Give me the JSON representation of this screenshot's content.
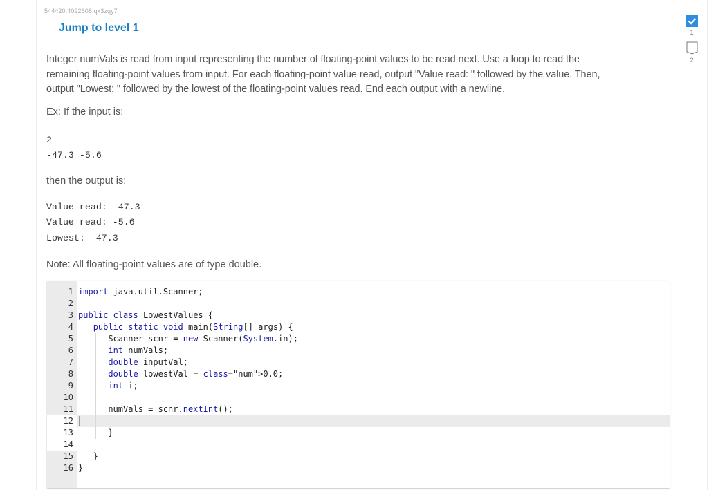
{
  "header": {
    "activity_id": "544420.4092608.qx3zqy7",
    "jump_link": "Jump to level 1"
  },
  "prompt": {
    "text": "Integer numVals is read from input representing the number of floating-point values to be read next. Use a loop to read the remaining floating-point values from input. For each floating-point value read, output \"Value read: \" followed by the value. Then, output \"Lowest: \" followed by the lowest of the floating-point values read. End each output with a newline.",
    "lines": [
      "Integer numVals is read from input representing the number of floating-point values to be read next. Use a loop to read the",
      "remaining floating-point values from input. For each floating-point value read, output \"Value read: \" followed by the value. Then,",
      "output \"Lowest: \" followed by the lowest of the floating-point values read. End each output with a newline."
    ],
    "example_input_label": "Ex: If the input is:",
    "example_input": [
      "2",
      "-47.3 -5.6"
    ],
    "example_output_label": "then the output is:",
    "example_output": [
      "Value read: -47.3",
      "Value read: -5.6",
      "Lowest: -47.3"
    ],
    "note": "Note: All floating-point values are of type double."
  },
  "editor": {
    "active_line": 12,
    "lines": [
      {
        "n": "1",
        "code": "import java.util.Scanner;"
      },
      {
        "n": "2",
        "code": ""
      },
      {
        "n": "3",
        "code": "public class LowestValues {"
      },
      {
        "n": "4",
        "code": "   public static void main(String[] args) {"
      },
      {
        "n": "5",
        "code": "      Scanner scnr = new Scanner(System.in);"
      },
      {
        "n": "6",
        "code": "      int numVals;"
      },
      {
        "n": "7",
        "code": "      double inputVal;"
      },
      {
        "n": "8",
        "code": "      double lowestVal = 0.0;"
      },
      {
        "n": "9",
        "code": "      int i;"
      },
      {
        "n": "10",
        "code": ""
      },
      {
        "n": "11",
        "code": "      numVals = scnr.nextInt();"
      },
      {
        "n": "12",
        "code": ""
      },
      {
        "n": "13",
        "code": "      }"
      },
      {
        "n": "14",
        "code": ""
      },
      {
        "n": "15",
        "code": "   }"
      },
      {
        "n": "16",
        "code": "}"
      }
    ]
  },
  "progress": {
    "steps": [
      {
        "label": "1",
        "status": "complete",
        "icon": "checkmark-icon"
      },
      {
        "label": "2",
        "status": "incomplete",
        "icon": "empty-level-icon"
      }
    ],
    "colors": {
      "complete": "#2f8de4",
      "incomplete_border": "#777777"
    }
  }
}
